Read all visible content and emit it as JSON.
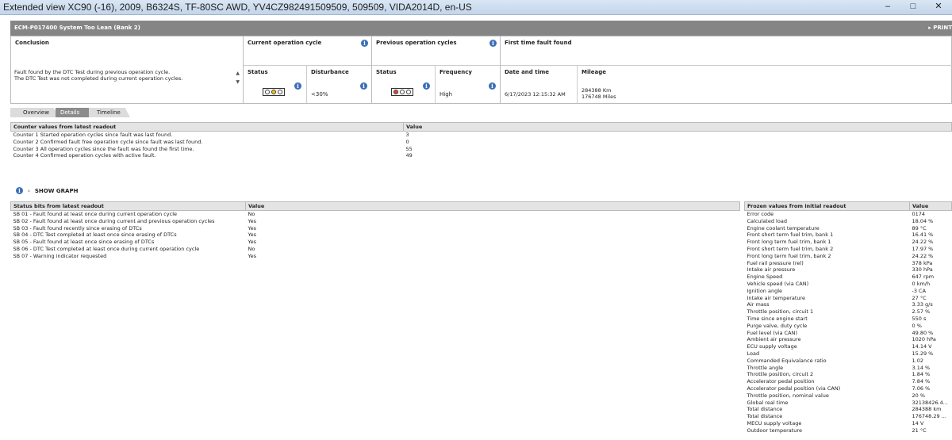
{
  "window": {
    "title": "Extended view   XC90 (-16), 2009, B6324S, TF-80SC AWD, YV4CZ982491509509, 509509, VIDA2014D, en-US"
  },
  "panel": {
    "title": "ECM-P017400 System Too Lean (Bank 2)",
    "print_label": "PRINT"
  },
  "conclusion": {
    "header": "Conclusion",
    "text": "Fault found by the DTC Test during previous operation cycle.\nThe DTC Test was not completed during current operation cycles."
  },
  "current_cycle": {
    "header": "Current operation cycle",
    "status_label": "Status",
    "disturbance_label": "Disturbance",
    "disturbance_value": "<30%"
  },
  "previous_cycles": {
    "header": "Previous operation cycles",
    "status_label": "Status",
    "frequency_label": "Frequency",
    "frequency_value": "High"
  },
  "first_fault": {
    "header": "First time fault found",
    "date_label": "Date and time",
    "date_value": "6/17/2023 12:15:32 AM",
    "mileage_label": "Mileage",
    "mileage_km": "284388 Km",
    "mileage_miles": "176748 Miles"
  },
  "tabs": [
    "Overview",
    "Details",
    "Timeline"
  ],
  "counters": {
    "header": "Counter values from latest readout",
    "value_header": "Value",
    "rows": [
      {
        "label": "Counter 1 Started operation cycles since fault was last found.",
        "value": "3"
      },
      {
        "label": "Counter 2 Confirmed fault free operation cycle since fault was last found.",
        "value": "0"
      },
      {
        "label": "Counter 3 All operation cycles since the fault was found the first time.",
        "value": "55"
      },
      {
        "label": "Counter 4 Confirmed operation cycles with active fault.",
        "value": "49"
      }
    ]
  },
  "graph": {
    "label": "SHOW GRAPH"
  },
  "status_bits": {
    "header": "Status bits from latest readout",
    "value_header": "Value",
    "rows": [
      {
        "label": "SB 01 - Fault found at least once during current operation cycle",
        "value": "No"
      },
      {
        "label": "SB 02 - Fault found at least once during current and previous operation cycles",
        "value": "Yes"
      },
      {
        "label": "SB 03 - Fault found recently since erasing of DTCs",
        "value": "Yes"
      },
      {
        "label": "SB 04 - DTC Test completed at least once since erasing of DTCs",
        "value": "Yes"
      },
      {
        "label": "SB 05 - Fault found at least once since erasing of DTCs",
        "value": "Yes"
      },
      {
        "label": "SB 06 - DTC Test completed at least once during current operation cycle",
        "value": "No"
      },
      {
        "label": "SB 07 - Warning indicator requested",
        "value": "Yes"
      }
    ]
  },
  "frozen": {
    "header": "Frozen values from initial readout",
    "value_header": "Value",
    "rows": [
      {
        "label": "Error code",
        "value": "0174"
      },
      {
        "label": "Calculated load",
        "value": "18.04 %"
      },
      {
        "label": "Engine coolant temperature",
        "value": "89 °C"
      },
      {
        "label": "Front short term fuel trim, bank 1",
        "value": "16.41 %"
      },
      {
        "label": "Front long term fuel trim, bank 1",
        "value": "24.22 %"
      },
      {
        "label": "Front short term fuel trim, bank 2",
        "value": "17.97 %"
      },
      {
        "label": "Front long term fuel trim, bank 2",
        "value": "24.22 %"
      },
      {
        "label": "Fuel rail pressure (rel)",
        "value": "378 kPa"
      },
      {
        "label": "Intake air pressure",
        "value": "330 hPa"
      },
      {
        "label": "Engine Speed",
        "value": "647 rpm"
      },
      {
        "label": "Vehicle speed (via CAN)",
        "value": "0 km/h"
      },
      {
        "label": "Ignition angle",
        "value": "-3 CA"
      },
      {
        "label": "Intake air temperature",
        "value": "27 °C"
      },
      {
        "label": "Air mass",
        "value": "3.33 g/s"
      },
      {
        "label": "Throttle position, circuit 1",
        "value": "2.57 %"
      },
      {
        "label": "Time since engine start",
        "value": "550 s"
      },
      {
        "label": "Purge valve, duty cycle",
        "value": "0 %"
      },
      {
        "label": "Fuel level (via CAN)",
        "value": "49.80 %"
      },
      {
        "label": "Ambient air pressure",
        "value": "1020 hPa"
      },
      {
        "label": "ECU supply voltage",
        "value": "14.14 V"
      },
      {
        "label": "Load",
        "value": "15.29 %"
      },
      {
        "label": "Commanded Equivalance ratio",
        "value": "1.02"
      },
      {
        "label": "Throttle angle",
        "value": "3.14 %"
      },
      {
        "label": "Throttle position, circuit 2",
        "value": "1.84 %"
      },
      {
        "label": "Accelerator pedal position",
        "value": "7.84 %"
      },
      {
        "label": "Accelerator pedal position (via CAN)",
        "value": "7.06 %"
      },
      {
        "label": "Throttle position, nominal value",
        "value": "20 %"
      },
      {
        "label": "Global real time",
        "value": "32138426.4..."
      },
      {
        "label": "Total distance",
        "value": "284388 km"
      },
      {
        "label": "Total distance",
        "value": "176748.29 ..."
      },
      {
        "label": "MECU supply voltage",
        "value": "14 V"
      },
      {
        "label": "Outdoor temperature",
        "value": "21 °C"
      }
    ]
  },
  "colors": {
    "accent": "#3a6fb7",
    "header_bg": "#858585",
    "lamp_yellow": "#f2c40d",
    "lamp_red": "#e0452a"
  }
}
